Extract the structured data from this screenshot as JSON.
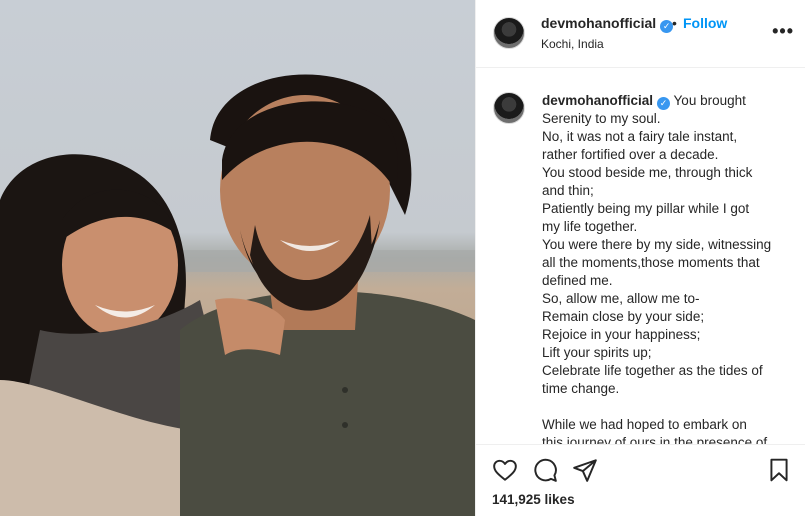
{
  "post": {
    "username": "devmohanofficial",
    "verified_mark": "✓",
    "separator": "•",
    "follow_label": "Follow",
    "location": "Kochi, India",
    "more_label": "•••",
    "image_alt": "Couple smiling together by the sea"
  },
  "caption": {
    "username": "devmohanofficial",
    "lines": [
      "You brought",
      "Serenity to my soul.",
      "No, it was not a fairy tale instant,",
      "rather fortified over a decade.",
      "You stood beside me, through thick",
      "and thin;",
      "Patiently being my pillar while I got",
      "my life together.",
      "You were there by my side, witnessing",
      "all the moments,those moments that",
      "defined me.",
      "So, allow me, allow me to-",
      "Remain close by your side;",
      "Rejoice in your happiness;",
      "Lift your spirits up;",
      "Celebrate life together as the tides of",
      "time change.",
      "",
      "While we had hoped to embark on",
      "this journey of ours in the presence of"
    ]
  },
  "actions": {
    "like_icon": "heart-icon",
    "comment_icon": "comment-icon",
    "share_icon": "paper-plane-icon",
    "save_icon": "bookmark-icon",
    "likes_text": "141,925 likes"
  },
  "colors": {
    "accent": "#0095f6",
    "verified": "#3897f0",
    "text": "#262626",
    "border": "#efefef"
  }
}
